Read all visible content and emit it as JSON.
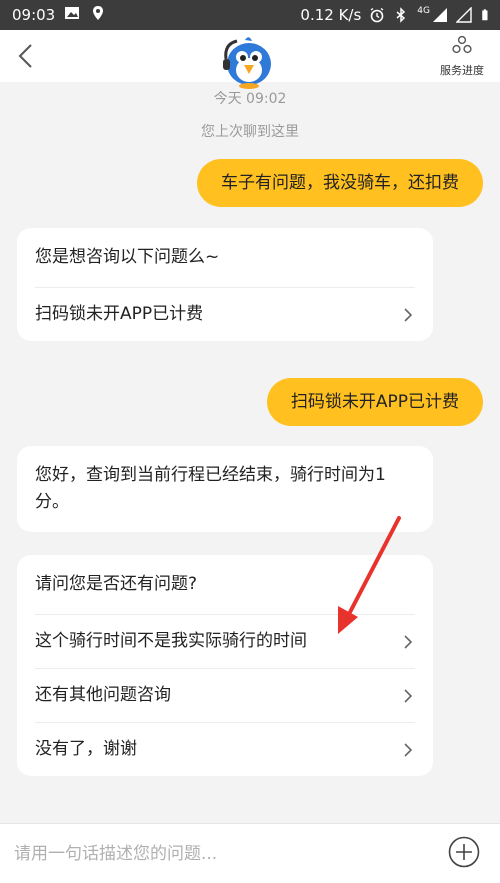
{
  "status_bar": {
    "time": "09:03",
    "network_speed": "0.12 K/s",
    "network_type": "4G"
  },
  "header": {
    "progress_label": "服务进度"
  },
  "chat": {
    "date_text": "今天 09:02",
    "last_chat_notice": "您上次聊到这里",
    "messages": [
      {
        "from": "user",
        "text": "车子有问题，我没骑车，还扣费"
      },
      {
        "from": "bot",
        "title": "您是想咨询以下问题么~",
        "options": [
          "扫码锁未开APP已计费"
        ]
      },
      {
        "from": "user",
        "text": "扫码锁未开APP已计费"
      },
      {
        "from": "bot",
        "title": "您好，查询到当前行程已经结束，骑行时间为1分。"
      },
      {
        "from": "bot",
        "title": "请问您是否还有问题?",
        "options": [
          "这个骑行时间不是我实际骑行的时间",
          "还有其他问题咨询",
          "没有了，谢谢"
        ]
      }
    ]
  },
  "input": {
    "placeholder": "请用一句话描述您的问题..."
  },
  "colors": {
    "accent": "#ffc020",
    "status_bar": "#3c3c3c",
    "annotation_arrow": "#e8322c"
  }
}
